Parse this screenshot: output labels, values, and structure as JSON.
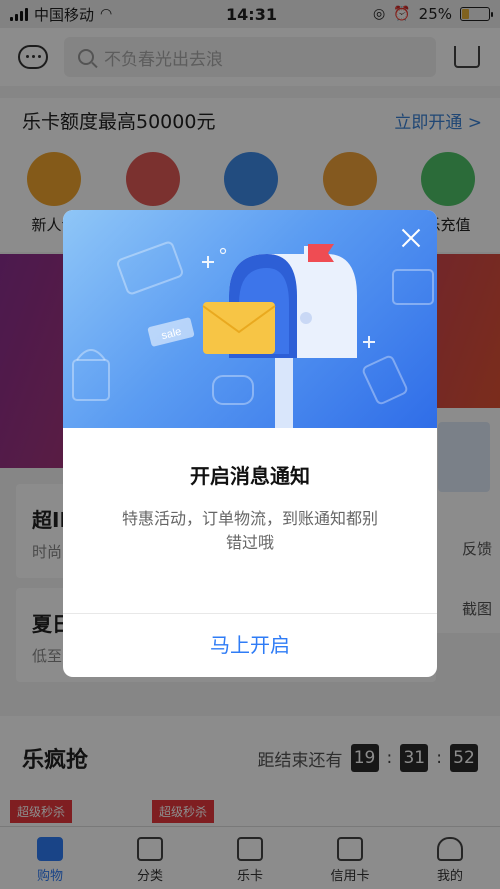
{
  "status_bar": {
    "carrier": "中国移动",
    "time": "14:31",
    "battery_percent": "25%",
    "battery_level": 0.25
  },
  "header": {
    "search_placeholder": "不负春光出去浪",
    "message_icon": "chat-bubble-icon",
    "cart_icon": "shopping-cart-icon"
  },
  "promo": {
    "text": "乐卡额度最高50000元",
    "link": "立即开通 >"
  },
  "quick_icons": [
    {
      "label": "新人专",
      "color": "#f1a52e"
    },
    {
      "label": "",
      "color": "#e05a57"
    },
    {
      "label": "",
      "color": "#3f8be8"
    },
    {
      "label": "",
      "color": "#f0a23a"
    },
    {
      "label": "乐充值",
      "color": "#4fc468"
    }
  ],
  "cards": [
    {
      "title": "超IN",
      "subtitle": "时尚"
    },
    {
      "title": "夏日",
      "subtitle": "低至"
    }
  ],
  "side_panel": {
    "feedback": "反馈",
    "screenshot": "截图"
  },
  "flash_sale": {
    "title": "乐疯抢",
    "countdown_label": "距结束还有",
    "hours": "19",
    "minutes": "31",
    "seconds": "52",
    "tag": "超级秒杀"
  },
  "tabs": [
    {
      "label": "购物",
      "active": true
    },
    {
      "label": "分类",
      "active": false
    },
    {
      "label": "乐卡",
      "active": false
    },
    {
      "label": "信用卡",
      "active": false
    },
    {
      "label": "我的",
      "active": false
    }
  ],
  "dialog": {
    "title": "开启消息通知",
    "description": "特惠活动，订单物流，到账通知都别错过哦",
    "button": "马上开启",
    "sale_sticker": "sale"
  }
}
